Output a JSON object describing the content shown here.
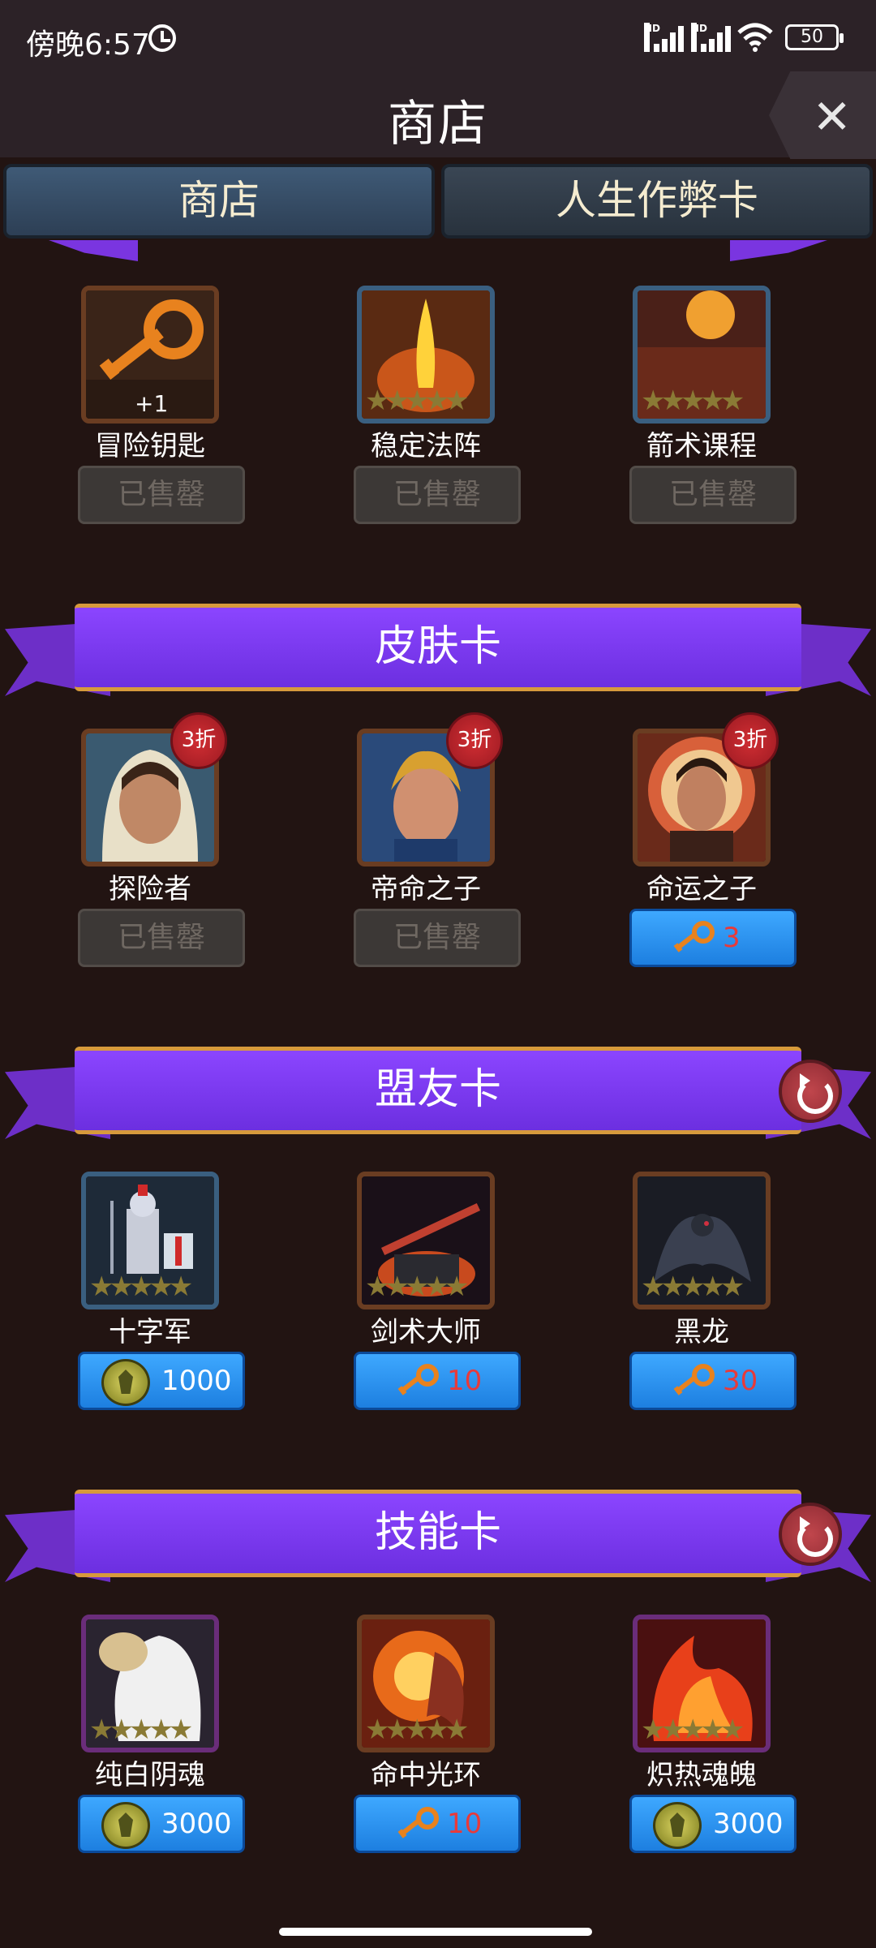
{
  "status_bar": {
    "time": "傍晚6:57",
    "battery": "50"
  },
  "header": {
    "title": "商店"
  },
  "tabs": [
    {
      "label": "商店"
    },
    {
      "label": "人生作弊卡"
    }
  ],
  "section_top": {
    "items": [
      {
        "name": "冒险钥匙",
        "badge": "+1",
        "button": "已售罄"
      },
      {
        "name": "稳定法阵",
        "button": "已售罄"
      },
      {
        "name": "箭术课程",
        "button": "已售罄"
      }
    ]
  },
  "section_skin": {
    "title": "皮肤卡",
    "items": [
      {
        "name": "探险者",
        "discount": "3折",
        "button": "已售罄"
      },
      {
        "name": "帝命之子",
        "discount": "3折",
        "button": "已售罄"
      },
      {
        "name": "命运之子",
        "discount": "3折",
        "price": "3",
        "currency": "key-icon"
      }
    ]
  },
  "section_ally": {
    "title": "盟友卡",
    "items": [
      {
        "name": "十字军",
        "price": "1000",
        "currency": "coin-icon"
      },
      {
        "name": "剑术大师",
        "price": "10",
        "currency": "key-icon"
      },
      {
        "name": "黑龙",
        "price": "30",
        "currency": "key-icon"
      }
    ]
  },
  "section_skill": {
    "title": "技能卡",
    "items": [
      {
        "name": "纯白阴魂",
        "price": "3000",
        "currency": "coin-icon"
      },
      {
        "name": "命中光环",
        "price": "10",
        "currency": "key-icon"
      },
      {
        "name": "炽热魂魄",
        "price": "3000",
        "currency": "coin-icon"
      }
    ]
  },
  "colors": {
    "ribbon": "#7b3cf0",
    "buy_button": "#2a8ff0",
    "price_red": "#e83a3a",
    "background": "#221412"
  }
}
